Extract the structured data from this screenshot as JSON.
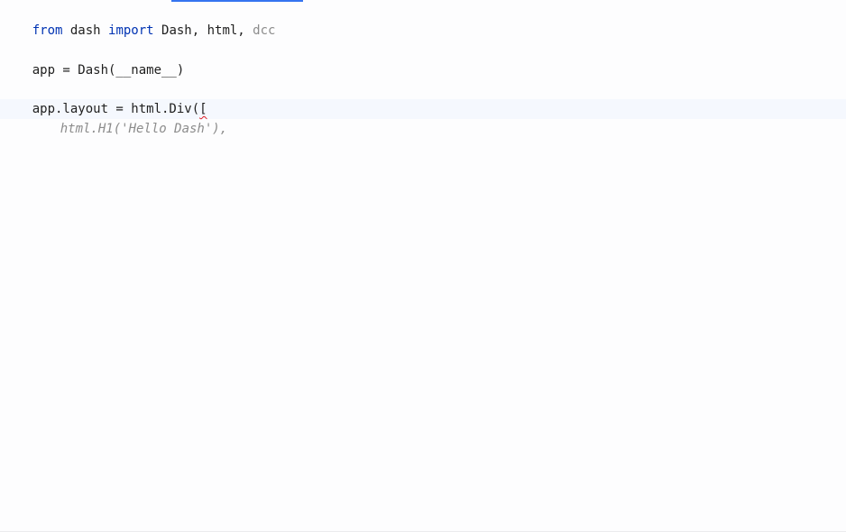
{
  "editor": {
    "lines": [
      {
        "from_kw": "from",
        "module": " dash ",
        "import_kw": "import",
        "names_used": " Dash, html, ",
        "name_unused": "dcc"
      },
      {
        "text": ""
      },
      {
        "text": "app = Dash(__name__)"
      },
      {
        "text": ""
      },
      {
        "text_main": "app.layout = html.Div(",
        "text_marked": "["
      },
      {
        "ghost": "html.H1('Hello Dash'),"
      }
    ]
  }
}
